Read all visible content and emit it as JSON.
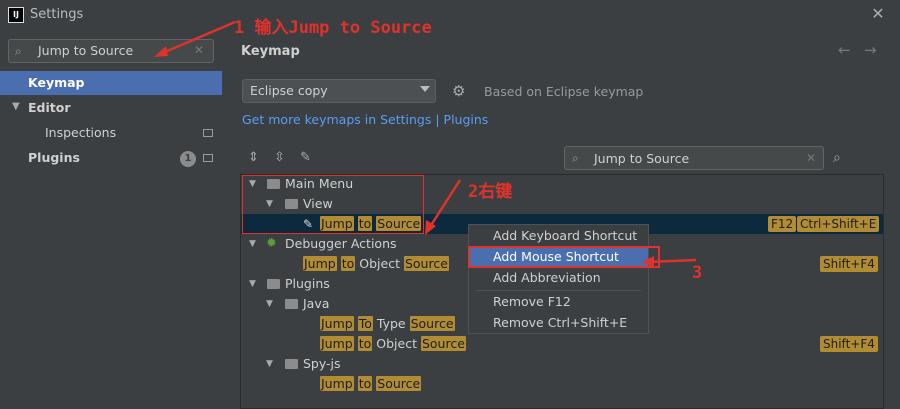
{
  "window": {
    "title": "Settings",
    "app_icon": "intellij-icon",
    "close_glyph": "✕"
  },
  "sidebar": {
    "search_value": "Jump to Source",
    "items": [
      {
        "label": "Keymap"
      },
      {
        "label": "Editor"
      },
      {
        "label": "Inspections"
      },
      {
        "label": "Plugins",
        "badge": "1"
      }
    ]
  },
  "panel": {
    "title": "Keymap",
    "keymap_selected": "Eclipse copy",
    "based_on": "Based on Eclipse keymap",
    "link": "Get more keymaps in Settings | Plugins",
    "tree_search_value": "Jump to Source"
  },
  "tree": {
    "main_menu": "Main Menu",
    "view": "View",
    "jump_to_source": [
      "Jump",
      "to",
      "Source"
    ],
    "shortcut_f12": "F12",
    "shortcut_ctrl": "Ctrl+Shift+E",
    "debugger_actions": "Debugger Actions",
    "jump_to_object_source": [
      "Jump",
      "to",
      "Object",
      "Source"
    ],
    "shortcut_shift_f4": "Shift+F4",
    "plugins": "Plugins",
    "java": "Java",
    "jump_to_type_source": [
      "Jump",
      "To",
      "Type",
      "Source"
    ],
    "jump_to_object_source_java": [
      "Jump",
      "to",
      "Object",
      "Source"
    ],
    "shortcut_shift_f4_java": "Shift+F4",
    "spy_js": "Spy-js",
    "jump_to_source_spy": [
      "Jump",
      "to",
      "Source"
    ]
  },
  "context_menu": {
    "items": [
      "Add Keyboard Shortcut",
      "Add Mouse Shortcut",
      "Add Abbreviation",
      "Remove F12",
      "Remove Ctrl+Shift+E"
    ]
  },
  "annotations": {
    "step1": "1 输入Jump to Source",
    "step2": "2右键",
    "step3": "3"
  },
  "colors": {
    "accent": "#4b6eaf",
    "highlight": "#b18c33",
    "annotation": "#e0322c",
    "link": "#589df6"
  }
}
